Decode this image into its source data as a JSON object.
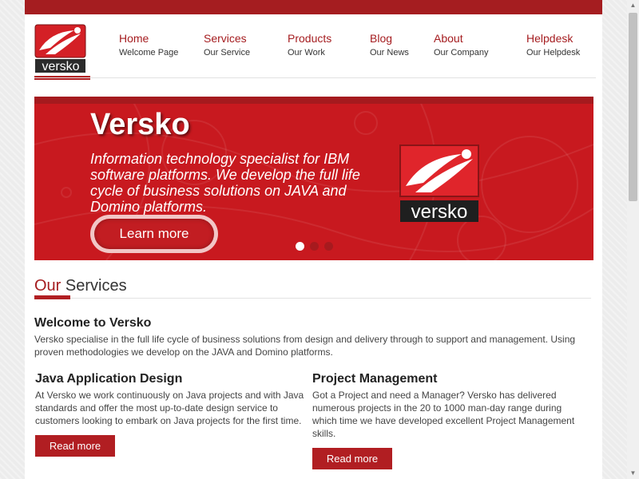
{
  "logo": {
    "text": "versko"
  },
  "nav": [
    {
      "title": "Home",
      "sub": "Welcome Page"
    },
    {
      "title": "Services",
      "sub": "Our Service"
    },
    {
      "title": "Products",
      "sub": "Our Work"
    },
    {
      "title": "Blog",
      "sub": "Our News"
    },
    {
      "title": "About",
      "sub": "Our Company"
    },
    {
      "title": "Helpdesk",
      "sub": "Our Helpdesk"
    }
  ],
  "slider": {
    "title": "Versko",
    "text": "Information technology specialist for IBM software platforms. We develop the full life cycle of business solutions on JAVA and Domino platforms.",
    "button_label": "Learn more",
    "logo_text": "versko",
    "active_slide": 1,
    "slide_count": 3
  },
  "services": {
    "heading_accent": "Our",
    "heading_rest": " Services",
    "welcome_title": "Welcome to Versko",
    "welcome_text": "Versko specialise in the full life cycle of business solutions from design and delivery through to support and management. Using proven methodologies we develop on the JAVA and Domino platforms.",
    "columns": [
      {
        "title": "Java Application Design",
        "text": "At Versko we work continuously on Java projects and with Java standards and offer the most up-to-date design service to customers looking to embark on Java projects for the first time.",
        "button": "Read more"
      },
      {
        "title": "Project Management",
        "text": "Got a Project and need a Manager? Versko has delivered numerous projects in the 20 to 1000 man-day range during which time we have developed excellent Project Management skills.",
        "button": "Read more"
      }
    ]
  },
  "colors": {
    "brand": "#a51d20",
    "slider_bg": "#c8191f",
    "button": "#b11e22"
  },
  "icons": {
    "scroll_up": "▲",
    "scroll_down": "▼"
  }
}
